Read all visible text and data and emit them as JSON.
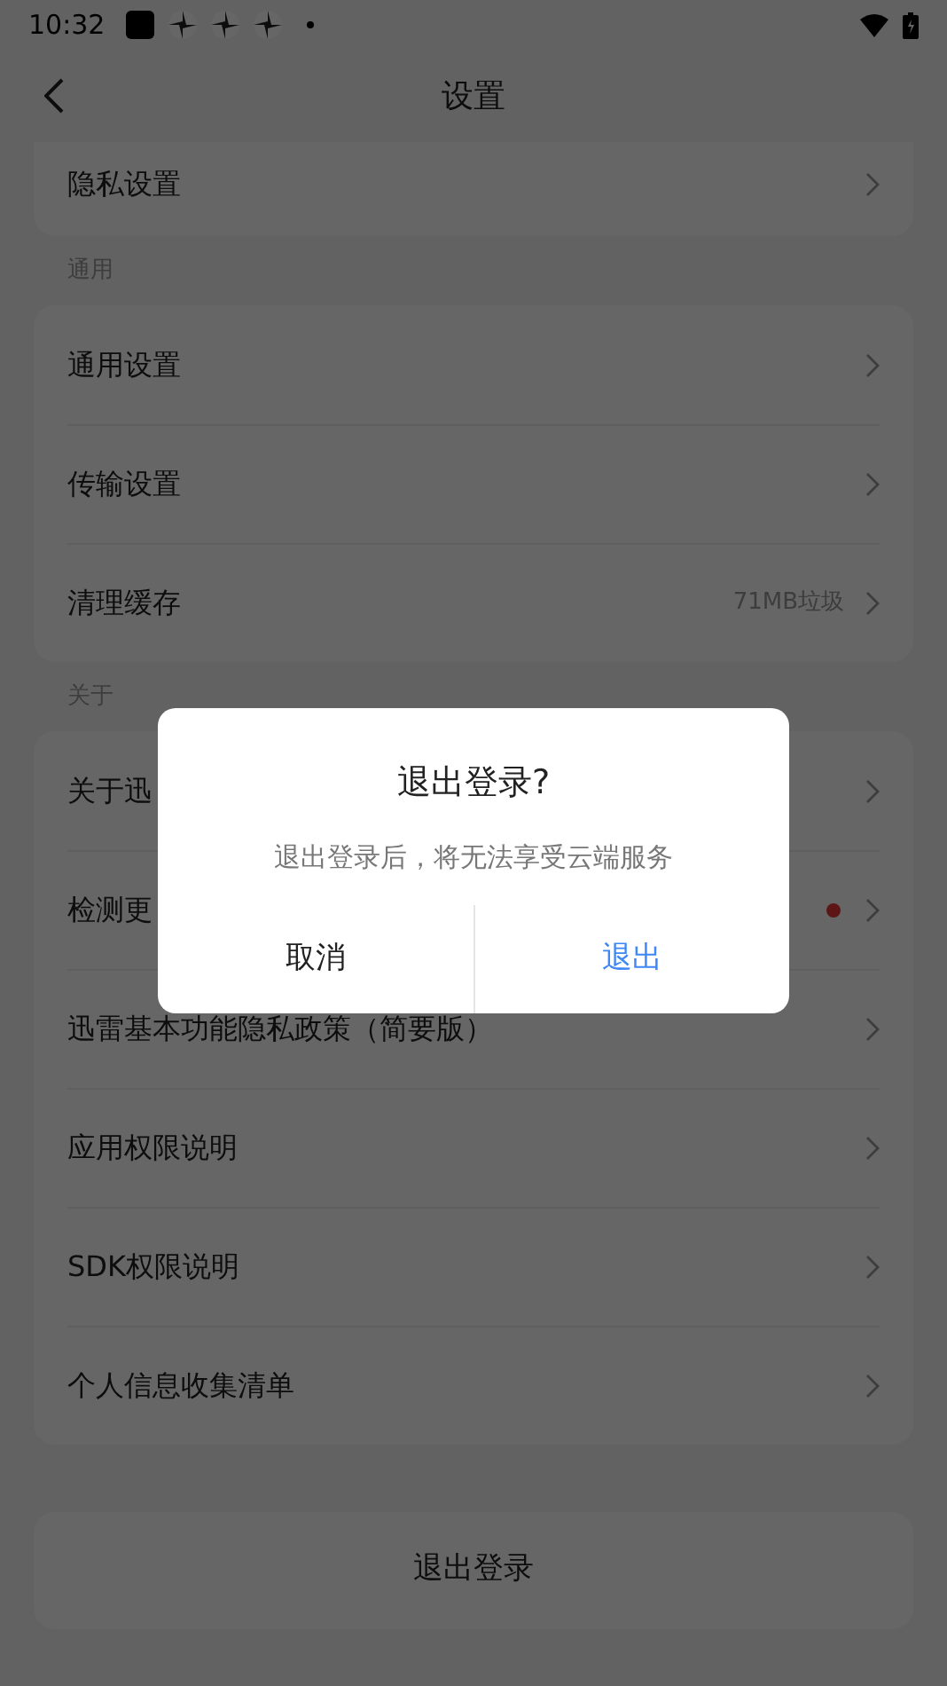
{
  "status_bar": {
    "time": "10:32"
  },
  "header": {
    "title": "设置"
  },
  "sections": [
    {
      "rows": [
        {
          "label": "隐私设置",
          "badge": false
        }
      ]
    },
    {
      "title": "通用",
      "rows": [
        {
          "label": "通用设置",
          "badge": false
        },
        {
          "label": "传输设置",
          "badge": false
        },
        {
          "label": "清理缓存",
          "detail": "71MB垃圾",
          "badge": false
        }
      ]
    },
    {
      "title": "关于",
      "rows": [
        {
          "label": "关于迅",
          "badge": false
        },
        {
          "label": "检测更",
          "badge": true
        },
        {
          "label": "迅雷基本功能隐私政策（简要版）",
          "badge": false
        },
        {
          "label": "应用权限说明",
          "badge": false
        },
        {
          "label": "SDK权限说明",
          "badge": false
        },
        {
          "label": "个人信息收集清单",
          "badge": false
        }
      ]
    }
  ],
  "logout_button": "退出登录",
  "dialog": {
    "title": "退出登录?",
    "message": "退出登录后，将无法享受云端服务",
    "buttons": [
      {
        "label": "取消",
        "kind": "cancel"
      },
      {
        "label": "退出",
        "kind": "confirm"
      }
    ]
  }
}
